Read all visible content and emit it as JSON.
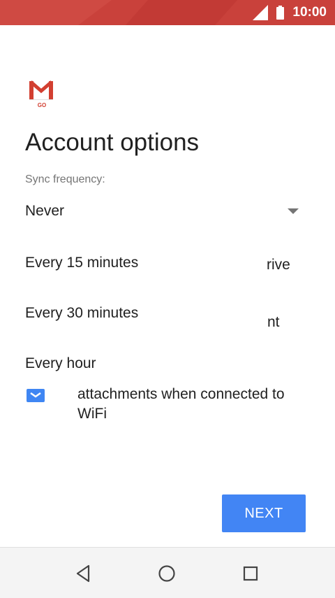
{
  "status_bar": {
    "time": "10:00"
  },
  "logo": {
    "text": "GO"
  },
  "title": "Account options",
  "sync_label": "Sync frequency:",
  "sync_select": {
    "selected": "Never",
    "options": [
      "Every 15 minutes",
      "Every 30 minutes",
      "Every hour"
    ]
  },
  "background_partial": {
    "line1": "rive",
    "line2": "nt"
  },
  "wifi_option": {
    "checked": true,
    "label": "attachments when connected to WiFi"
  },
  "next_label": "NEXT",
  "colors": {
    "accent": "#4285f4",
    "status_bar": "#c9413b"
  }
}
